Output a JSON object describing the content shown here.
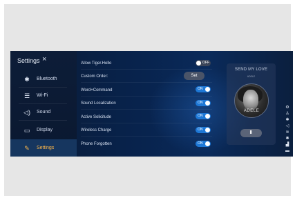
{
  "sidebar": {
    "title": "Settings",
    "close_icon": "×",
    "items": [
      {
        "label": "Bluetooth",
        "icon": "bluetooth-icon",
        "glyph": "✱"
      },
      {
        "label": "Wi-Fi",
        "icon": "wifi-icon",
        "glyph": "☰"
      },
      {
        "label": "Sound",
        "icon": "speaker-icon",
        "glyph": "◁)"
      },
      {
        "label": "Display",
        "icon": "display-icon",
        "glyph": "▭"
      },
      {
        "label": "Settings",
        "icon": "wrench-icon",
        "glyph": "✎"
      }
    ],
    "active_item": "Settings",
    "accent_color": "#ffb84a"
  },
  "settings": [
    {
      "label": "Allow Tiger.Hello",
      "control": "toggle",
      "state": "OFF"
    },
    {
      "label": "Custom Order:",
      "control": "button",
      "button_label": "Set"
    },
    {
      "label": "Word+Command",
      "control": "toggle",
      "state": "ON"
    },
    {
      "label": "Sound Localization",
      "control": "toggle",
      "state": "ON"
    },
    {
      "label": "Active Solicitude",
      "control": "toggle",
      "state": "ON"
    },
    {
      "label": "Wireless Charge",
      "control": "toggle",
      "state": "ON"
    },
    {
      "label": "Phone Forgotten",
      "control": "toggle",
      "state": "ON"
    }
  ],
  "media": {
    "song": "SEND MY LOVE",
    "artist": "ADELE",
    "album_text": "ADELE",
    "pause_glyph": "II"
  },
  "status_icons": [
    "gear-icon",
    "person-icon",
    "bluetooth-icon",
    "speaker-icon",
    "wifi-icon",
    "bluetooth-icon",
    "signal-icon",
    "battery-icon"
  ],
  "status_glyphs": [
    "⚙",
    "♙",
    "✱",
    "◁",
    "≋",
    "✱",
    "▟",
    "▬"
  ],
  "colors": {
    "toggle_on": "#1e78d6",
    "toggle_off": "#3a4458",
    "background": "#08234d"
  }
}
